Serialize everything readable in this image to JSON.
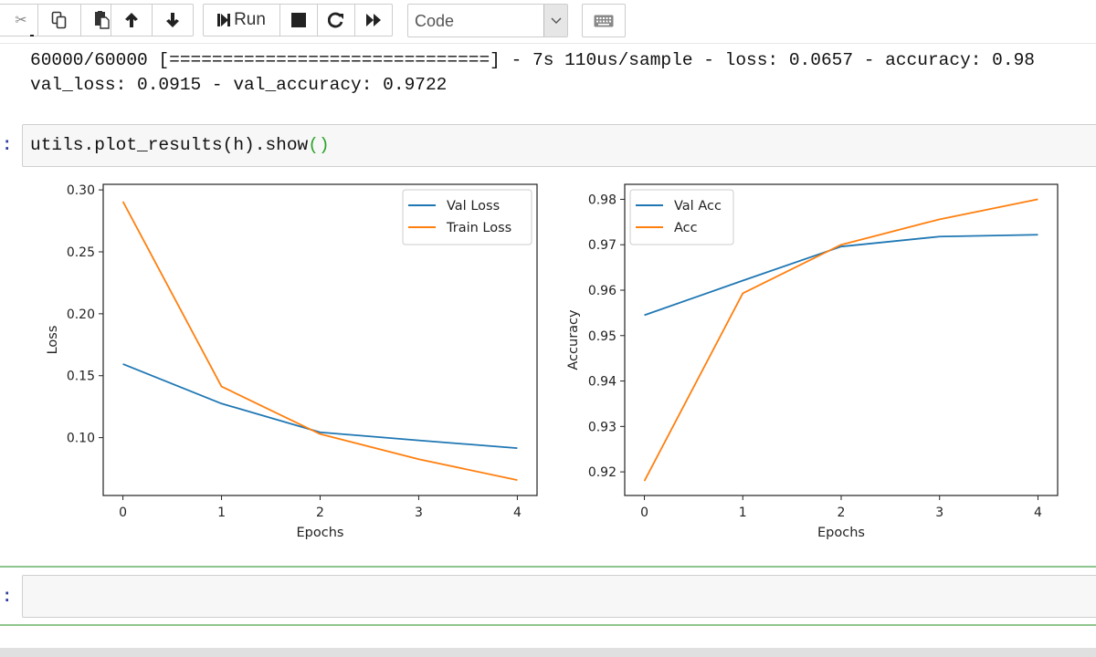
{
  "toolbar": {
    "buttons": [
      {
        "name": "cut",
        "icon": "scissors-icon"
      },
      {
        "name": "copy",
        "icon": "copy-icon"
      },
      {
        "name": "paste",
        "icon": "paste-icon"
      },
      {
        "name": "move-up",
        "icon": "arrow-up-icon"
      },
      {
        "name": "move-down",
        "icon": "arrow-down-icon"
      },
      {
        "name": "run",
        "icon": "step-forward-icon",
        "label": "Run"
      },
      {
        "name": "interrupt",
        "icon": "stop-icon"
      },
      {
        "name": "restart",
        "icon": "restart-icon"
      },
      {
        "name": "restart-run-all",
        "icon": "fast-forward-icon"
      }
    ],
    "run_label": "Run",
    "cell_type": "Code",
    "keyboard_icon": "keyboard-icon"
  },
  "output": {
    "line1": "60000/60000 [==============================] - 7s 110us/sample - loss: 0.0657 - accuracy: 0.98",
    "line2": "val_loss: 0.0915 - val_accuracy: 0.9722"
  },
  "cells": [
    {
      "prompt": ":",
      "code_main": "utils.plot_results(h).show",
      "code_parens": "()"
    },
    {
      "prompt": ":",
      "code_main": "",
      "code_parens": "",
      "selected": true
    }
  ],
  "colors": {
    "series_blue": "#1f77b4",
    "series_orange": "#ff7f0e",
    "selected_border": "#8fc58f",
    "prompt": "#303f9f"
  },
  "chart_data": [
    {
      "type": "line",
      "title": "",
      "xlabel": "Epochs",
      "ylabel": "Loss",
      "x": [
        0,
        1,
        2,
        3,
        4
      ],
      "xticks": [
        "0",
        "1",
        "2",
        "3",
        "4"
      ],
      "yticks": [
        "0.10",
        "0.15",
        "0.20",
        "0.25",
        "0.30"
      ],
      "ytick_values": [
        0.1,
        0.15,
        0.2,
        0.25,
        0.3
      ],
      "ylim": [
        0.0533,
        0.3045
      ],
      "xlim": [
        -0.2,
        4.2
      ],
      "legend": "top-right",
      "grid": false,
      "series": [
        {
          "name": "Val Loss",
          "color": "#1f77b4",
          "values": [
            0.1594,
            0.1275,
            0.1043,
            0.0978,
            0.0915
          ]
        },
        {
          "name": "Train Loss",
          "color": "#ff7f0e",
          "values": [
            0.2906,
            0.1413,
            0.1029,
            0.0826,
            0.0657
          ]
        }
      ]
    },
    {
      "type": "line",
      "title": "",
      "xlabel": "Epochs",
      "ylabel": "Accuracy",
      "x": [
        0,
        1,
        2,
        3,
        4
      ],
      "xticks": [
        "0",
        "1",
        "2",
        "3",
        "4"
      ],
      "yticks": [
        "0.92",
        "0.93",
        "0.94",
        "0.95",
        "0.96",
        "0.97",
        "0.98"
      ],
      "ytick_values": [
        0.92,
        0.93,
        0.94,
        0.95,
        0.96,
        0.97,
        0.98
      ],
      "ylim": [
        0.9148,
        0.9833
      ],
      "xlim": [
        -0.2,
        4.2
      ],
      "legend": "top-left",
      "grid": false,
      "series": [
        {
          "name": "Val Acc",
          "color": "#1f77b4",
          "values": [
            0.9545,
            0.9621,
            0.9696,
            0.9718,
            0.9722
          ]
        },
        {
          "name": "Acc",
          "color": "#ff7f0e",
          "values": [
            0.918,
            0.9593,
            0.97,
            0.9756,
            0.98
          ]
        }
      ]
    }
  ]
}
